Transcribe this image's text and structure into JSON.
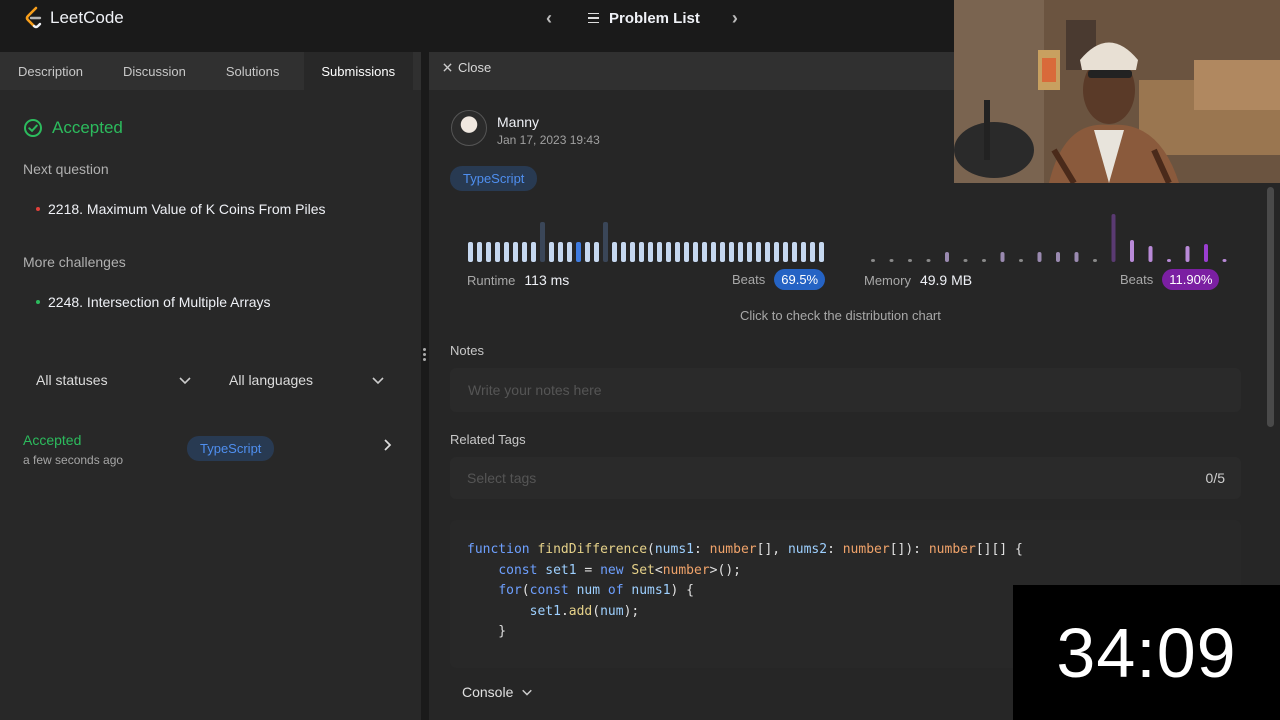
{
  "app": {
    "logo_text": "LeetCode",
    "problem_list_label": "Problem List"
  },
  "tabs": [
    {
      "label": "Description"
    },
    {
      "label": "Discussion"
    },
    {
      "label": "Solutions"
    },
    {
      "label": "Submissions"
    }
  ],
  "result": {
    "status": "Accepted",
    "next_question_label": "Next question",
    "next_question": "2218. Maximum Value of K Coins From Piles",
    "more_challenges_label": "More challenges",
    "more_challenge": "2248. Intersection of Multiple Arrays"
  },
  "filters": {
    "status": "All statuses",
    "language": "All languages"
  },
  "submission_row": {
    "status": "Accepted",
    "time": "a few seconds ago",
    "language": "TypeScript"
  },
  "detail": {
    "close_label": "Close",
    "user_name": "Manny",
    "date": "Jan 17, 2023 19:43",
    "language": "TypeScript",
    "runtime_label": "Runtime",
    "runtime_value": "113 ms",
    "runtime_beats_label": "Beats",
    "runtime_beats": "69.5%",
    "memory_label": "Memory",
    "memory_value": "49.9 MB",
    "memory_beats_label": "Beats",
    "memory_beats": "11.90%",
    "dist_hint": "Click to check the distribution chart",
    "notes_label": "Notes",
    "notes_placeholder": "Write your notes here",
    "tags_label": "Related Tags",
    "tags_placeholder": "Select tags",
    "tags_count": "0/5",
    "console_label": "Console"
  },
  "code_lines": [
    "function findDifference(nums1: number[], nums2: number[]): number[][] {",
    "    const set1 = new Set<number>();",
    "    for(const num of nums1) {",
    "        set1.add(num);",
    "    }"
  ],
  "timer": "34:09",
  "colors": {
    "accepted": "#2cbb5d",
    "runtime_badge": "#2563c4",
    "memory_badge": "#7b1fa2",
    "runtime_bar": "#c6d8f0",
    "runtime_bar_highlight": "#3e7be0",
    "memory_bar": "#b98ad8"
  }
}
